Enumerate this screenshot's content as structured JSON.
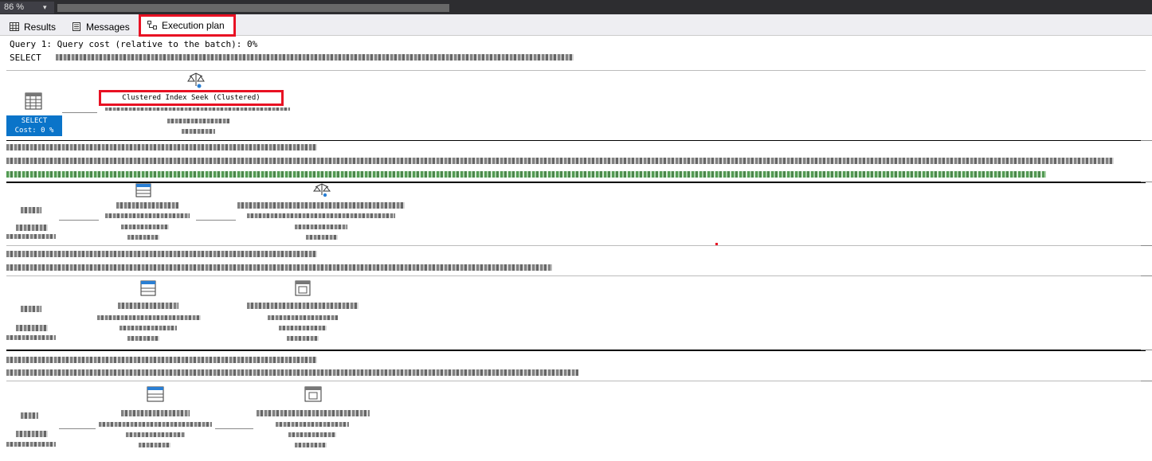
{
  "zoom": {
    "value": "86 %",
    "arrow": "▾"
  },
  "tabs": [
    {
      "label": "Results"
    },
    {
      "label": "Messages"
    },
    {
      "label": "Execution plan"
    }
  ],
  "query1": {
    "header": "Query 1: Query cost (relative to the batch): 0%",
    "sql_prefix": "SELECT",
    "select_node": {
      "label": "SELECT",
      "cost": "Cost: 0 %"
    },
    "seek_node": {
      "label": "Clustered Index Seek (Clustered)"
    }
  },
  "colors": {
    "accent_red": "#e81123",
    "select_blue": "#0a74c9",
    "missing_index_green": "#1a7a1a"
  },
  "icons": [
    "grid-icon",
    "messages-icon",
    "execution-plan-icon",
    "select-operator-icon",
    "index-seek-icon",
    "table-insert-icon",
    "table-valued-function-icon"
  ]
}
